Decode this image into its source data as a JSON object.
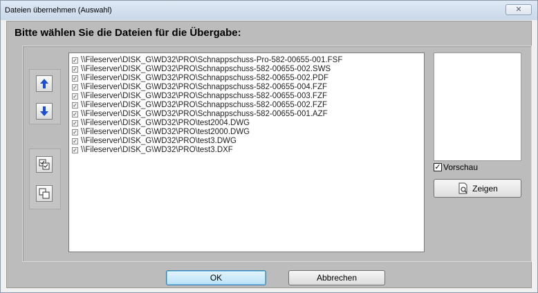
{
  "window": {
    "title": "Dateien übernehmen (Auswahl)",
    "close_glyph": "✕"
  },
  "heading": "Bitte wählen Sie die Dateien für die Übergabe:",
  "files": [
    "\\\\Fileserver\\DISK_G\\WD32\\PRO\\Schnappschuss-Pro-582-00655-001.FSF",
    "\\\\Fileserver\\DISK_G\\WD32\\PRO\\Schnappschuss-582-00655-002.SWS",
    "\\\\Fileserver\\DISK_G\\WD32\\PRO\\Schnappschuss-582-00655-002.PDF",
    "\\\\Fileserver\\DISK_G\\WD32\\PRO\\Schnappschuss-582-00655-004.FZF",
    "\\\\Fileserver\\DISK_G\\WD32\\PRO\\Schnappschuss-582-00655-003.FZF",
    "\\\\Fileserver\\DISK_G\\WD32\\PRO\\Schnappschuss-582-00655-002.FZF",
    "\\\\Fileserver\\DISK_G\\WD32\\PRO\\Schnappschuss-582-00655-001.AZF",
    "\\\\Fileserver\\DISK_G\\WD32\\PRO\\test2004.DWG",
    "\\\\Fileserver\\DISK_G\\WD32\\PRO\\test2000.DWG",
    "\\\\Fileserver\\DISK_G\\WD32\\PRO\\test3.DWG",
    "\\\\Fileserver\\DISK_G\\WD32\\PRO\\test3.DXF"
  ],
  "check_glyph": "✓",
  "preview": {
    "checkbox_label": "Vorschau",
    "checked": true
  },
  "buttons": {
    "zeigen": "Zeigen",
    "ok": "OK",
    "cancel": "Abbrechen"
  },
  "icons": {
    "move_up": "arrow-up-icon",
    "move_down": "arrow-down-icon",
    "select_all": "select-all-icon",
    "deselect_all": "deselect-all-icon",
    "zeigen": "magnifier-page-icon"
  },
  "colors": {
    "arrow_blue": "#1b4fd6",
    "ok_blue": "#b9e2f7"
  }
}
